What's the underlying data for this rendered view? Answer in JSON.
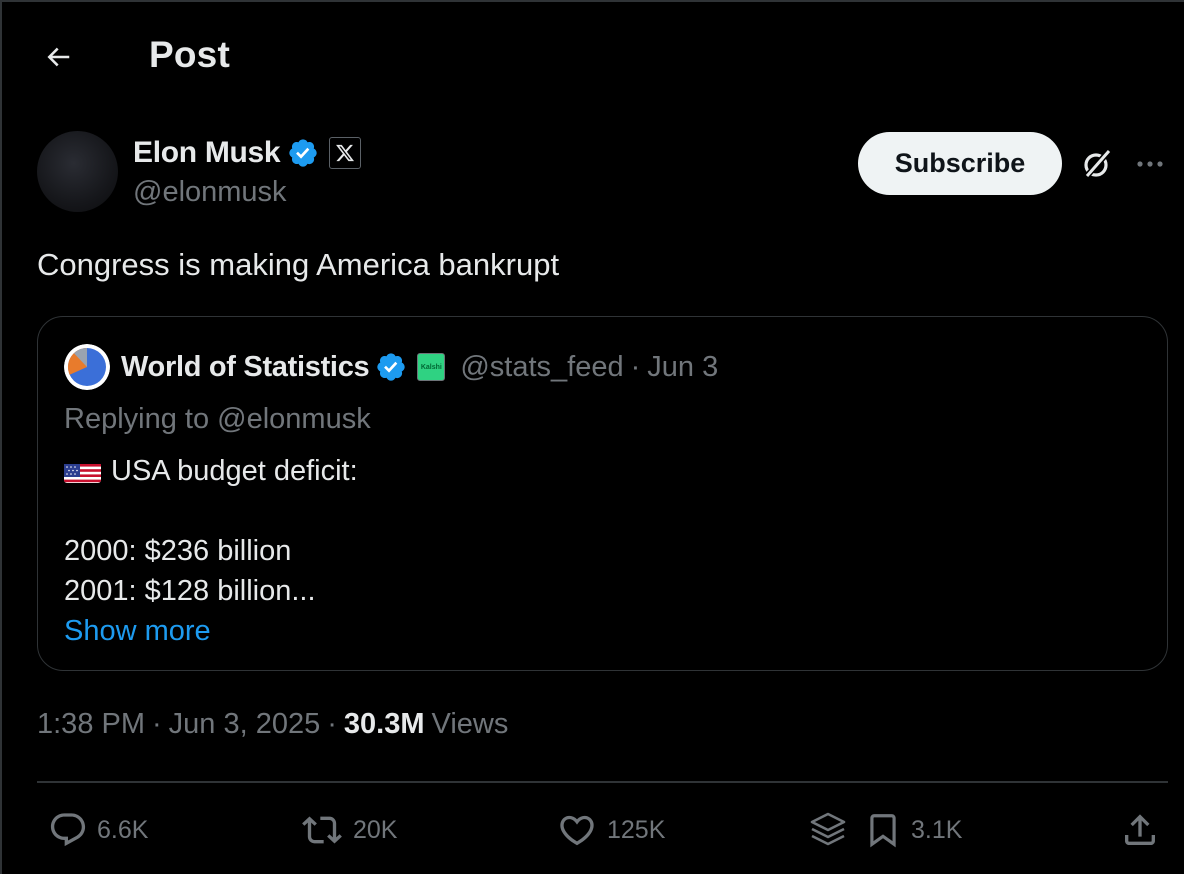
{
  "header": {
    "title": "Post",
    "back_icon": "arrow-left-icon"
  },
  "author": {
    "name": "Elon Musk",
    "handle": "@elonmusk",
    "verified_icon": "verified-badge-icon",
    "affiliation_icon": "x-logo-icon",
    "subscribe_label": "Subscribe",
    "grok_icon": "grok-icon",
    "more_icon": "more-horizontal-icon"
  },
  "tweet": {
    "text": "Congress is making America bankrupt"
  },
  "quote": {
    "name": "World of Statistics",
    "handle": "@stats_feed",
    "dot": "·",
    "date": "Jun 3",
    "affiliation_label": "Kalshi",
    "replying_to": "Replying to @elonmusk",
    "lines": [
      "USA budget deficit:",
      "2000: $236 billion",
      "2001: $128 billion..."
    ],
    "show_more": "Show more",
    "flag_icon": "us-flag-icon"
  },
  "meta": {
    "time": "1:38 PM",
    "sep": "·",
    "date": "Jun 3, 2025",
    "views_count": "30.3M",
    "views_label": "Views"
  },
  "actions": {
    "replies": "6.6K",
    "reposts": "20K",
    "likes": "125K",
    "bookmarks": "3.1K"
  },
  "colors": {
    "background": "#000000",
    "text": "#e7e9ea",
    "muted": "#71767b",
    "border": "#2f3336",
    "link": "#1d9bf0",
    "verified": "#1d9bf0"
  }
}
